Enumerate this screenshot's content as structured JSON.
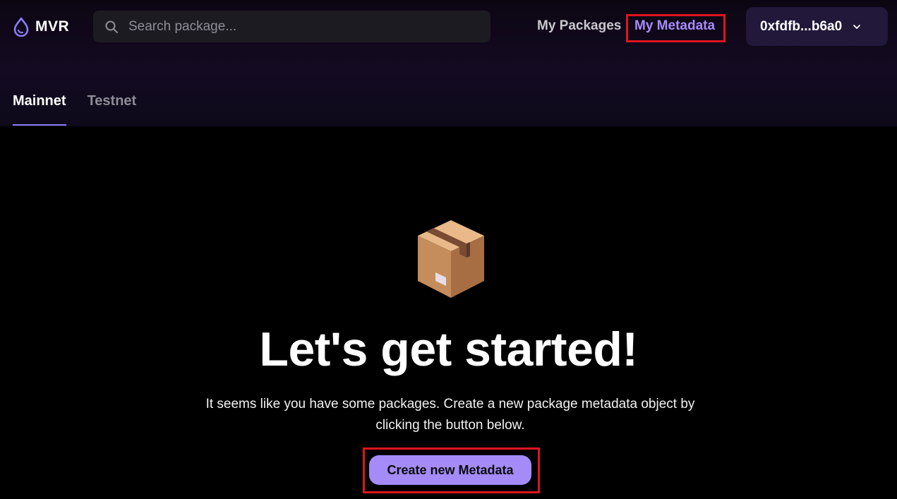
{
  "brand": {
    "name": "MVR",
    "icon": "droplet-icon",
    "accent": "#8b7cf6"
  },
  "search": {
    "placeholder": "Search package...",
    "value": ""
  },
  "nav": {
    "my_packages": "My Packages",
    "my_metadata": "My Metadata",
    "active": "My Metadata"
  },
  "wallet": {
    "label": "0xfdfb...b6a0"
  },
  "tabs": [
    {
      "label": "Mainnet",
      "active": true
    },
    {
      "label": "Testnet",
      "active": false
    }
  ],
  "empty_state": {
    "icon": "package-box-icon",
    "title": "Let's get started!",
    "description": "It seems like you have some packages. Create a new package metadata object by clicking the button below.",
    "button_label": "Create new Metadata"
  },
  "colors": {
    "background": "#000000",
    "accent_purple": "#a78bfa",
    "button_purple": "#a48bf8",
    "highlight_red": "#e0141e"
  }
}
